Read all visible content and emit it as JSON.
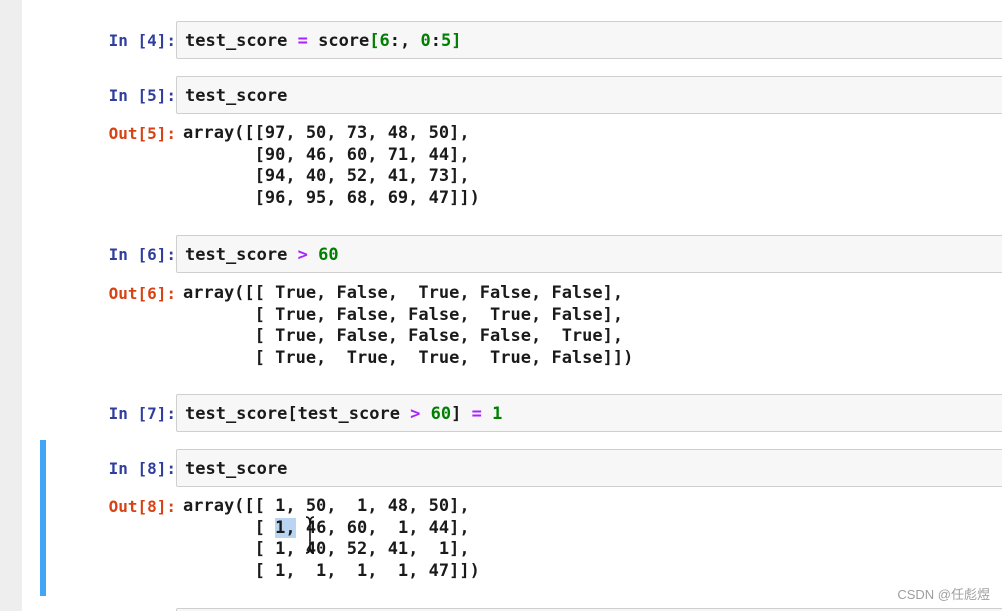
{
  "cells": [
    {
      "in_prompt": "In [4]:",
      "code": {
        "var": "test_score",
        "sp1": " ",
        "op": "=",
        "sp2": " score",
        "br_open": "[",
        "n1": "6",
        "mid": ":, ",
        "n2": "0",
        "colon": ":",
        "n3": "5",
        "br_close": "]"
      }
    },
    {
      "in_prompt": "In [5]:",
      "code": {
        "text": "test_score"
      },
      "out_prompt": "Out[5]:",
      "output": [
        "array([[97, 50, 73, 48, 50],",
        "       [90, 46, 60, 71, 44],",
        "       [94, 40, 52, 41, 73],",
        "       [96, 95, 68, 69, 47]])"
      ]
    },
    {
      "in_prompt": "In [6]:",
      "code": {
        "var": "test_score ",
        "op": ">",
        "num": " 60"
      },
      "out_prompt": "Out[6]:",
      "output": [
        "array([[ True, False,  True, False, False],",
        "       [ True, False, False,  True, False],",
        "       [ True, False, False, False,  True],",
        "       [ True,  True,  True,  True, False]])"
      ]
    },
    {
      "in_prompt": "In [7]:",
      "code": {
        "a": "test_score[test_score ",
        "op": ">",
        "n1": " 60",
        "b": "] ",
        "op2": "=",
        "n2": " 1"
      }
    },
    {
      "in_prompt": "In [8]:",
      "code": {
        "text": "test_score"
      },
      "out_prompt": "Out[8]:",
      "output": [
        "array([[ 1, 50,  1, 48, 50],",
        "       [ 1, 46, 60,  1, 44],",
        "       [ 1, 40, 52, 41,  1],",
        "       [ 1,  1,  1,  1, 47]])"
      ],
      "out8_row2": {
        "pre": "       [ ",
        "hl": "1,",
        "post": " 46, 60,  1, 44],"
      }
    }
  ],
  "watermark": "CSDN @任彪煜",
  "colors": {
    "in_prompt": "#303f9f",
    "out_prompt": "#d84315",
    "keyword_op": "#aa22ff",
    "number": "#008000",
    "selected_bar": "#42a5f5"
  }
}
